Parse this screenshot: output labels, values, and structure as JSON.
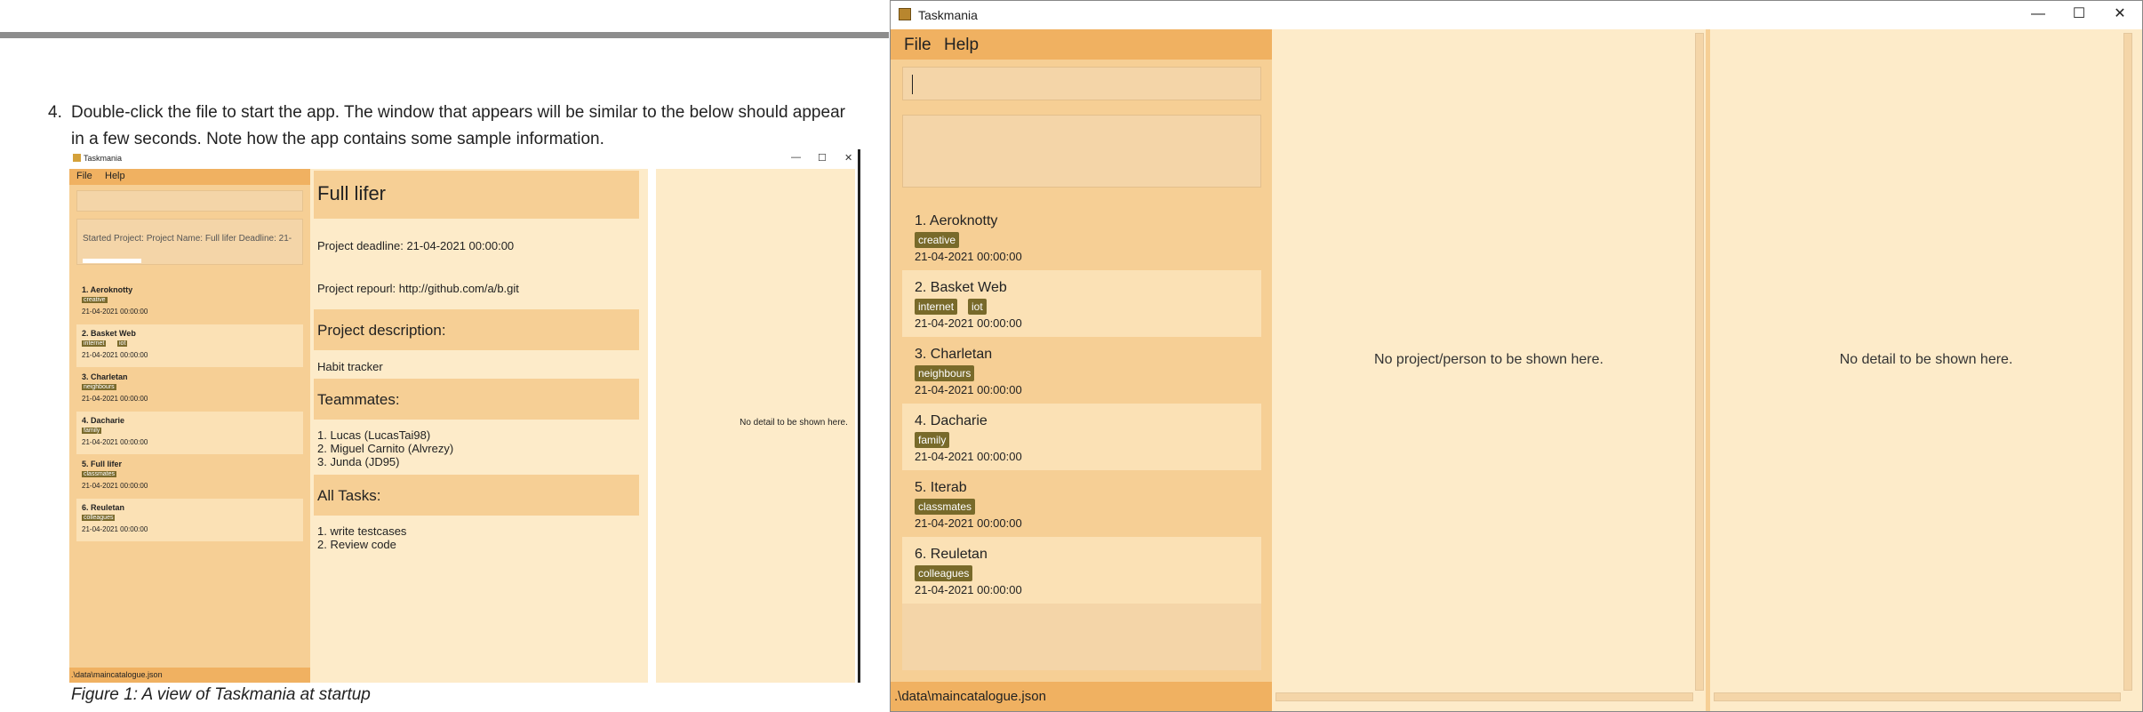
{
  "doc": {
    "step_number": "4.",
    "step_text": "Double-click the file to start the app. The window that appears will be similar to the below should appear in a few seconds. Note how the app contains some sample information.",
    "caption": "Figure 1: A view of Taskmania at startup"
  },
  "figure": {
    "title": "Taskmania",
    "menu": [
      "File",
      "Help"
    ],
    "result_text": "Started Project:  Project Name: Full lifer Deadline: 21-",
    "projects": [
      {
        "label": "1.  Aeroknotty",
        "tags": [
          "creative"
        ],
        "date": "21-04-2021 00:00:00"
      },
      {
        "label": "2.  Basket Web",
        "tags": [
          "internet",
          "iot"
        ],
        "date": "21-04-2021 00:00:00"
      },
      {
        "label": "3.  Charletan",
        "tags": [
          "neighbours"
        ],
        "date": "21-04-2021 00:00:00"
      },
      {
        "label": "4.  Dacharie",
        "tags": [
          "family"
        ],
        "date": "21-04-2021 00:00:00"
      },
      {
        "label": "5.  Full lifer",
        "tags": [
          "classmates"
        ],
        "date": "21-04-2021 00:00:00"
      },
      {
        "label": "6.  Reuletan",
        "tags": [
          "colleagues"
        ],
        "date": "21-04-2021 00:00:00"
      }
    ],
    "status": ".\\data\\maincatalogue.json",
    "detail": {
      "name": "Full lifer",
      "deadline": "Project deadline: 21-04-2021 00:00:00",
      "repo": "Project repourl: http://github.com/a/b.git",
      "desc_header": "Project description:",
      "desc": "Habit tracker",
      "team_header": "Teammates:",
      "team": [
        "1. Lucas (LucasTai98)",
        "2. Miguel Carnito (Alvrezy)",
        "3. Junda (JD95)"
      ],
      "tasks_header": "All Tasks:",
      "tasks": [
        "1. write testcases",
        "2. Review code"
      ]
    },
    "right_msg": "No detail to be shown here."
  },
  "window": {
    "title": "Taskmania",
    "controls": {
      "minimize": "—",
      "maximize": "☐",
      "close": "✕"
    },
    "menu": {
      "file": "File",
      "help": "Help"
    },
    "projects": [
      {
        "label": "1.  Aeroknotty",
        "tags": [
          "creative"
        ],
        "date": "21-04-2021 00:00:00"
      },
      {
        "label": "2.  Basket Web",
        "tags": [
          "internet",
          "iot"
        ],
        "date": "21-04-2021 00:00:00"
      },
      {
        "label": "3.  Charletan",
        "tags": [
          "neighbours"
        ],
        "date": "21-04-2021 00:00:00"
      },
      {
        "label": "4.  Dacharie",
        "tags": [
          "family"
        ],
        "date": "21-04-2021 00:00:00"
      },
      {
        "label": "5.  Iterab",
        "tags": [
          "classmates"
        ],
        "date": "21-04-2021 00:00:00"
      },
      {
        "label": "6.  Reuletan",
        "tags": [
          "colleagues"
        ],
        "date": "21-04-2021 00:00:00"
      }
    ],
    "status": ".\\data\\maincatalogue.json",
    "middle_msg": "No project/person to be shown here.",
    "right_msg": "No detail to be shown here."
  },
  "colors": {
    "menu_bg": "#f0b161",
    "panel_bg": "#f6cf95",
    "detail_bg": "#fdebc9",
    "tag_bg": "#786a2a"
  }
}
